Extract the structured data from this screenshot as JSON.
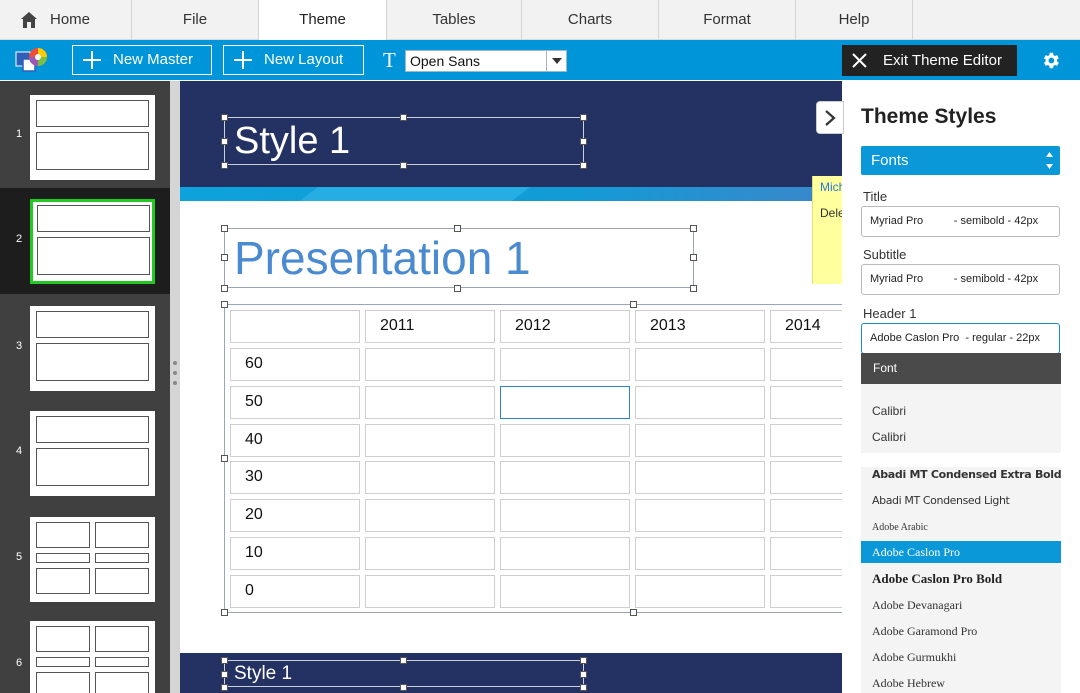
{
  "tabs": [
    {
      "label": "Home"
    },
    {
      "label": "File"
    },
    {
      "label": "Theme"
    },
    {
      "label": "Tables"
    },
    {
      "label": "Charts"
    },
    {
      "label": "Format"
    },
    {
      "label": "Help"
    }
  ],
  "toolbar": {
    "new_master": "New Master",
    "new_layout": "New Layout",
    "font_value": "Open Sans",
    "font_icon": "T",
    "exit": "Exit Theme Editor"
  },
  "slides": [
    {
      "num": "1"
    },
    {
      "num": "2"
    },
    {
      "num": "3"
    },
    {
      "num": "4"
    },
    {
      "num": "5"
    },
    {
      "num": "6"
    }
  ],
  "slide": {
    "title": "Style 1",
    "presentation_title": "Presentation 1",
    "footer": "Style 1",
    "table_header": [
      "",
      "2011",
      "2012",
      "2013",
      "2014"
    ],
    "table_rows": [
      "60",
      "50",
      "40",
      "30",
      "20",
      "10",
      "0"
    ]
  },
  "comment": {
    "author": "Mich",
    "text": "Dele"
  },
  "panel": {
    "title": "Theme Styles",
    "category": "Fonts",
    "title_label": "Title",
    "title_value": "Myriad Pro          - semibold - 42px",
    "subtitle_label": "Subtitle",
    "subtitle_value": "Myriad Pro          - semibold - 42px",
    "header1_label": "Header 1",
    "header1_value": "Adobe Caslon Pro  - regular - 22px",
    "font_header": "Font",
    "font_options": [
      "Calibri",
      "Calibri",
      "Abadi MT Condensed Extra Bold",
      "Abadi MT Condensed Light",
      "Adobe Arabic",
      "Adobe Caslon Pro",
      "Adobe Caslon Pro Bold",
      "Adobe Devanagari",
      "Adobe Garamond Pro",
      "Adobe Gurmukhi",
      "Adobe Hebrew"
    ],
    "selected_font": "Adobe Caslon Pro"
  },
  "colors": {
    "toolbar": "#0095d8",
    "navy": "#233163",
    "accent": "#0b98d8",
    "title_blue": "#4a8ad0",
    "thumb_active": "#22c922"
  }
}
